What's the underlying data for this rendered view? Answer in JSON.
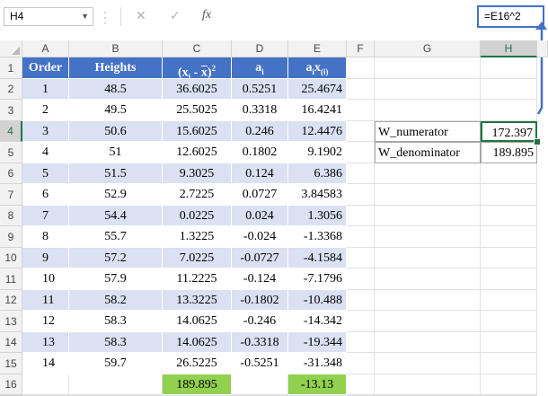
{
  "formula_bar": {
    "name_box": "H4",
    "cancel_glyph": "✕",
    "enter_glyph": "✓",
    "fx_glyph": "fx",
    "formula": "=E16^2"
  },
  "columns": [
    "A",
    "B",
    "C",
    "D",
    "E",
    "F",
    "G",
    "H"
  ],
  "rows": [
    "1",
    "2",
    "3",
    "4",
    "5",
    "6",
    "7",
    "8",
    "9",
    "10",
    "11",
    "12",
    "13",
    "14",
    "15",
    "16"
  ],
  "selected_column": "H",
  "selected_row": "4",
  "table": {
    "headers": [
      "Order",
      "Heights",
      "(x - x̄)²",
      "a",
      "ax"
    ],
    "header_parts": {
      "c_base": "(x",
      "c_sub": "i",
      "c_mid": " - ",
      "c_bar": "x",
      "c_close": ")",
      "c_sup": "2",
      "d_base": "a",
      "d_sub": "i",
      "e_base": "a",
      "e_sub1": "i",
      "e_mid": "x",
      "e_sub2": "(i)"
    },
    "data": [
      [
        "1",
        "48.5",
        "36.6025",
        "0.5251",
        "25.4674"
      ],
      [
        "2",
        "49.5",
        "25.5025",
        "0.3318",
        "16.4241"
      ],
      [
        "3",
        "50.6",
        "15.6025",
        "0.246",
        "12.4476"
      ],
      [
        "4",
        "51",
        "12.6025",
        "0.1802",
        "9.1902"
      ],
      [
        "5",
        "51.5",
        "9.3025",
        "0.124",
        "6.386"
      ],
      [
        "6",
        "52.9",
        "2.7225",
        "0.0727",
        "3.84583"
      ],
      [
        "7",
        "54.4",
        "0.0225",
        "0.024",
        "1.3056"
      ],
      [
        "8",
        "55.7",
        "1.3225",
        "-0.024",
        "-1.3368"
      ],
      [
        "9",
        "57.2",
        "7.0225",
        "-0.0727",
        "-4.1584"
      ],
      [
        "10",
        "57.9",
        "11.2225",
        "-0.124",
        "-7.1796"
      ],
      [
        "11",
        "58.2",
        "13.3225",
        "-0.1802",
        "-10.488"
      ],
      [
        "12",
        "58.3",
        "14.0625",
        "-0.246",
        "-14.342"
      ],
      [
        "13",
        "58.3",
        "14.0625",
        "-0.3318",
        "-19.344"
      ],
      [
        "14",
        "59.7",
        "26.5225",
        "-0.5251",
        "-31.348"
      ]
    ],
    "totals": {
      "c": "189.895",
      "e": "-13.13"
    }
  },
  "side_table": [
    {
      "label": "W_numerator",
      "value": "172.397"
    },
    {
      "label": "W_denominator",
      "value": "189.895"
    }
  ],
  "colors": {
    "header_blue": "#4472c4",
    "band_blue": "#d9e1f2",
    "total_green": "#92d050",
    "select_green": "#217346"
  }
}
